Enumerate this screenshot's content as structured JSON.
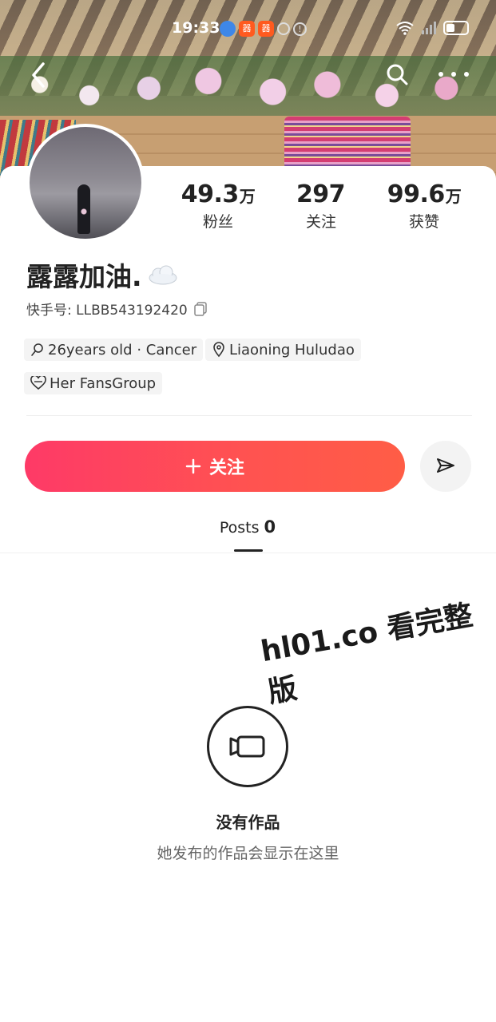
{
  "status_bar": {
    "time": "19:33",
    "badge_label": "器"
  },
  "profile": {
    "username": "露露加油.",
    "id_label": "快手号: LLBB543192420",
    "stats": [
      {
        "value": "49.3",
        "unit": "万",
        "label": "粉丝"
      },
      {
        "value": "297",
        "unit": "",
        "label": "关注"
      },
      {
        "value": "99.6",
        "unit": "万",
        "label": "获赞"
      }
    ],
    "tags": {
      "age_sign": "26years old · Cancer",
      "location": "Liaoning Huludao",
      "fans_group": "Her FansGroup"
    }
  },
  "actions": {
    "follow_label": "关注"
  },
  "tabs": {
    "posts_label": "Posts",
    "posts_count": "0"
  },
  "empty_state": {
    "title": "没有作品",
    "subtitle": "她发布的作品会显示在这里"
  },
  "watermark": "hl01.co 看完整版",
  "colors": {
    "follow_gradient_start": "#fe3a67",
    "follow_gradient_end": "#ff5d46",
    "text_primary": "#222222",
    "tag_bg": "#f4f4f4"
  },
  "icons": [
    "back-icon",
    "search-icon",
    "more-icon",
    "copy-icon",
    "search-tag-icon",
    "location-icon",
    "heart-icon",
    "plus-icon",
    "send-icon",
    "video-camera-icon",
    "cloud-icon"
  ]
}
